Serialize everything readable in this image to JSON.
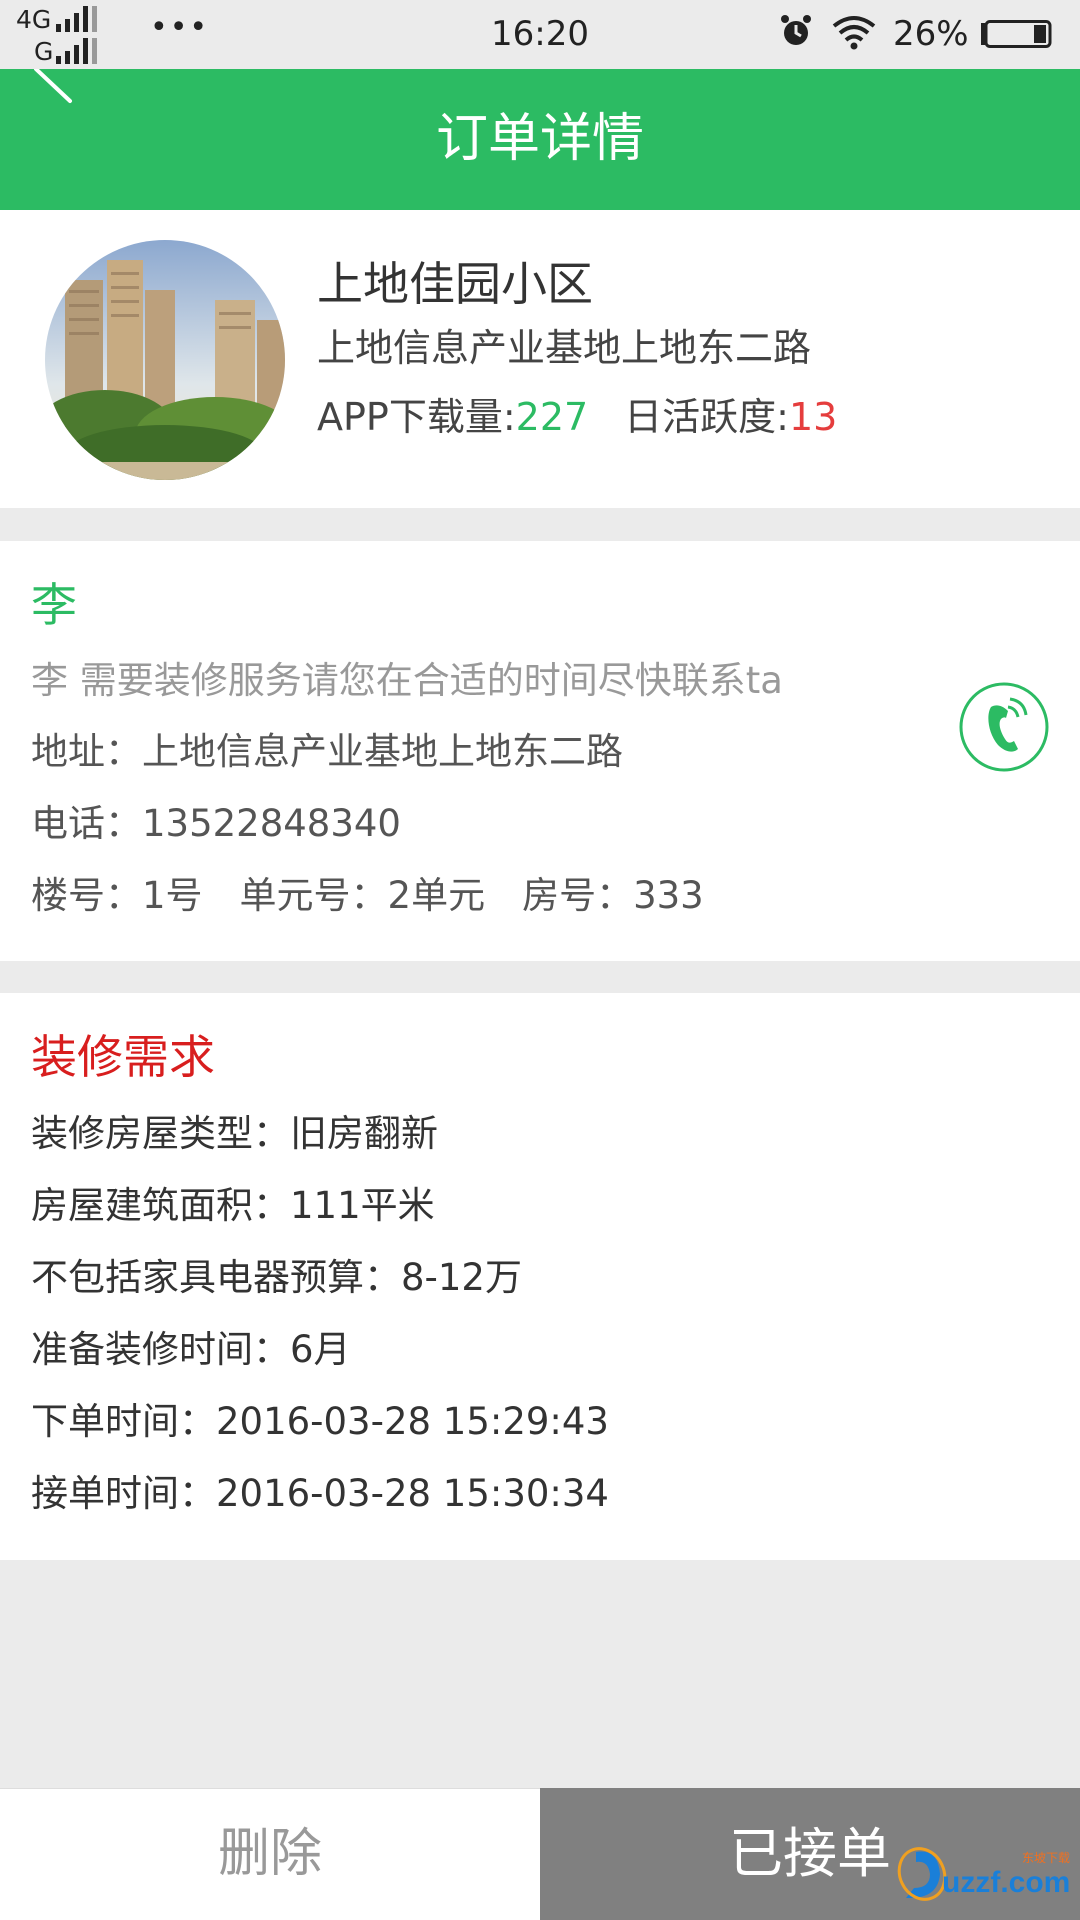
{
  "status_bar": {
    "network_top": "4G",
    "network_bottom": "G",
    "dots": "•••",
    "time": "16:20",
    "battery_percent": "26%",
    "icons": [
      "alarm-icon",
      "wifi-icon",
      "battery-icon"
    ]
  },
  "header": {
    "title": "订单详情",
    "back_icon": "back-arrow-icon"
  },
  "community": {
    "name": "上地佳园小区",
    "address": "上地信息产业基地上地东二路",
    "downloads_label": "APP下载量:",
    "downloads_value": "227",
    "activity_label": "日活跃度:",
    "activity_value": "13"
  },
  "customer": {
    "name": "李",
    "message": "李 需要装修服务请您在合适的时间尽快联系ta",
    "address": "地址：上地信息产业基地上地东二路",
    "phone": "电话：13522848340",
    "building": "楼号：1号　单元号：2单元　房号：333",
    "call_icon": "phone-call-icon"
  },
  "requirements": {
    "title": "装修需求",
    "house_type": "装修房屋类型：旧房翻新",
    "area": "房屋建筑面积：111平米",
    "budget": "不包括家具电器预算：8-12万",
    "start_time": "准备装修时间：6月",
    "order_time": "下单时间：2016-03-28 15:29:43",
    "accept_time": "接单时间：2016-03-28 15:30:34"
  },
  "actions": {
    "delete_label": "删除",
    "accepted_label": "已接单"
  },
  "watermark": {
    "text": "uzzf.com",
    "small_text": "东坡下载"
  },
  "colors": {
    "brand_green": "#2cbb63",
    "accent_red": "#e53d3d",
    "title_red": "#d81e1e",
    "button_gray": "#808080",
    "background": "#ebebeb"
  }
}
